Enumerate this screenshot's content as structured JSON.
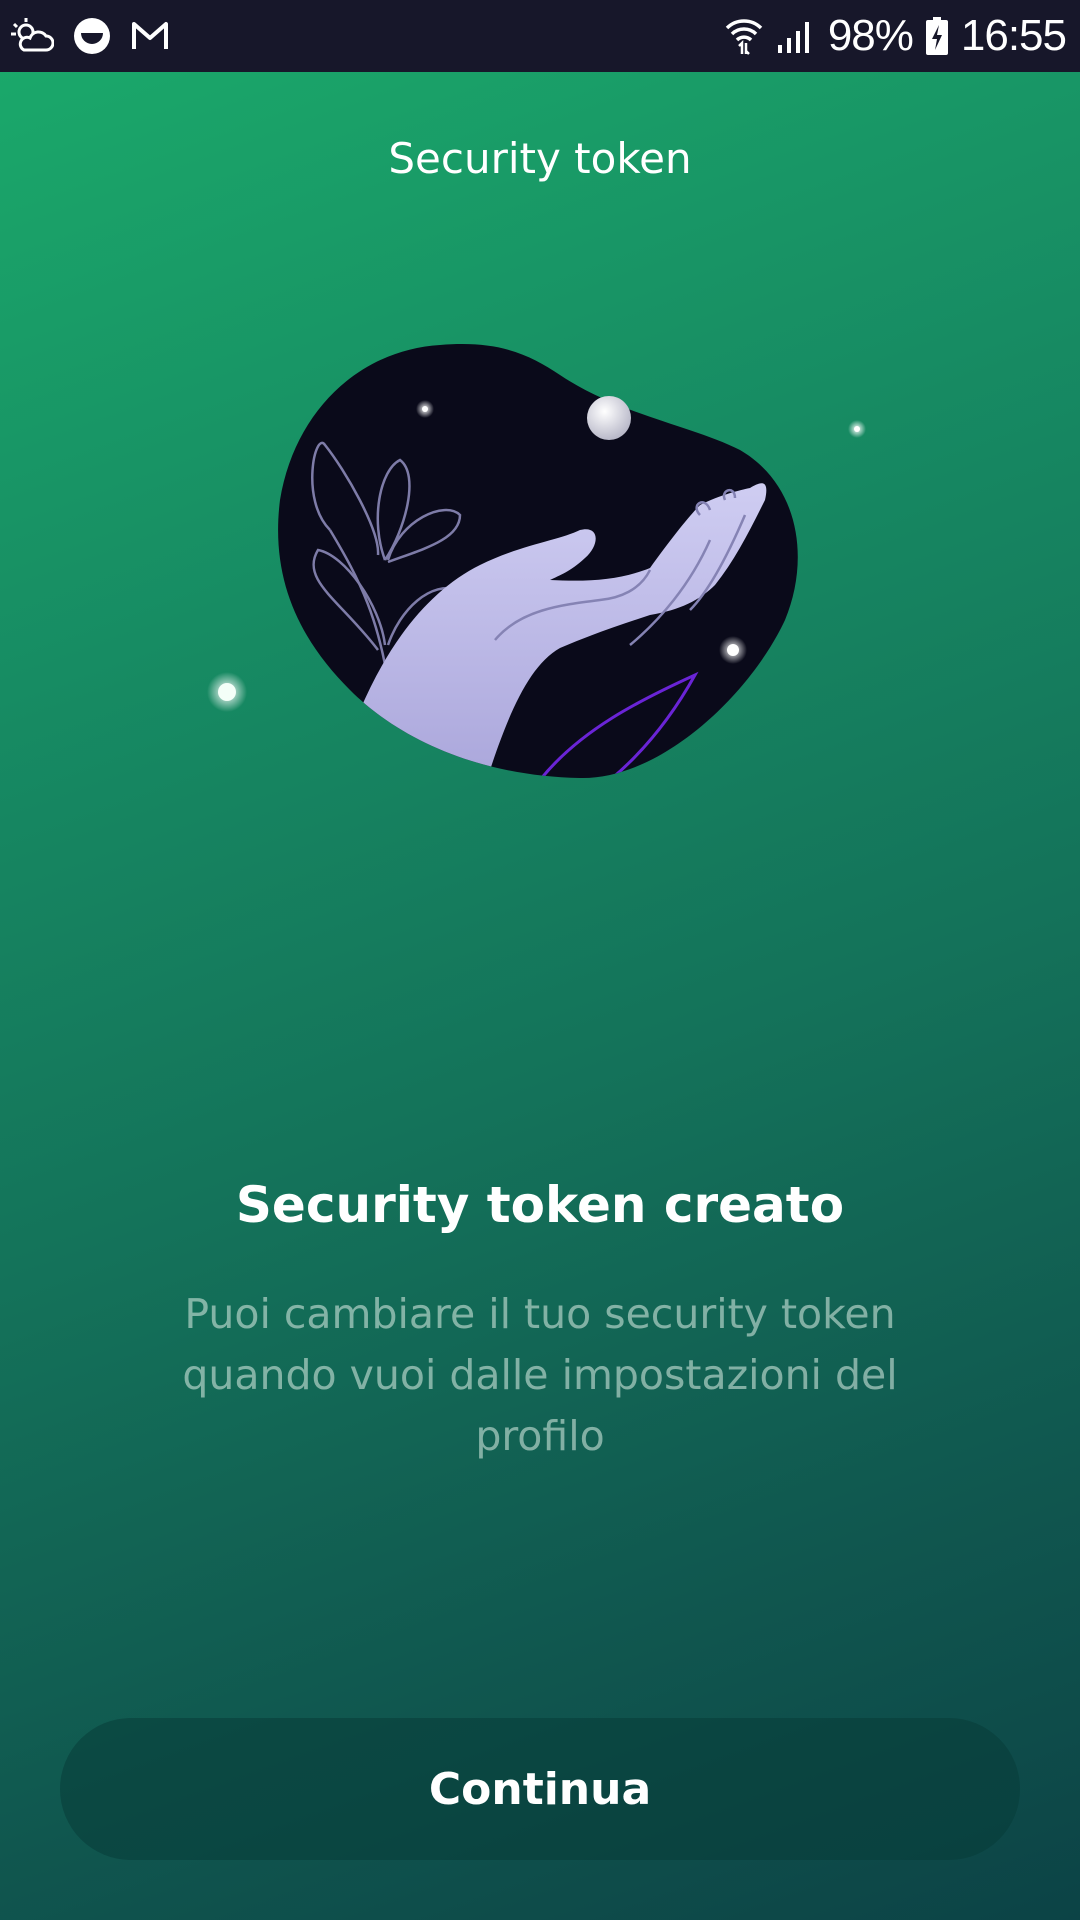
{
  "status_bar": {
    "icons_left": [
      "weather-cloud-sun-icon",
      "smile-app-icon",
      "gmail-icon"
    ],
    "icons_right": [
      "wifi-icon",
      "signal-icon",
      "battery-charging-icon"
    ],
    "battery_percent": "98%",
    "time": "16:55"
  },
  "header": {
    "title": "Security token"
  },
  "illustration": {
    "icon": "hand-holding-orb-illustration"
  },
  "main": {
    "headline": "Security token creato",
    "description": "Puoi cambiare il tuo security token quando vuoi dalle impostazioni del profilo"
  },
  "actions": {
    "continue_label": "Continua"
  },
  "colors": {
    "background_top": "#1bab6b",
    "background_bottom": "#0c4346",
    "status_bar": "#17172a",
    "blob": "#0a0a1a",
    "hand": "#c6c4ec"
  }
}
